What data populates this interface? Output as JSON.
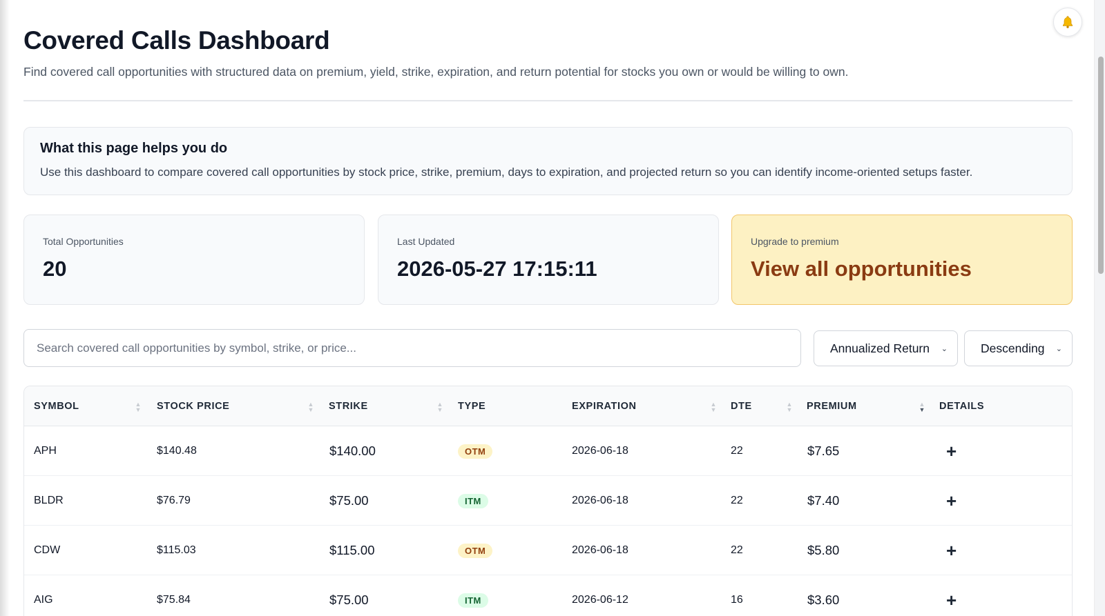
{
  "header": {
    "title": "Covered Calls Dashboard",
    "subtitle": "Find covered call opportunities with structured data on premium, yield, strike, expiration, and return potential for stocks you own or would be willing to own.",
    "bell_icon": "bell-icon"
  },
  "info": {
    "title": "What this page helps you do",
    "text": "Use this dashboard to compare covered call opportunities by stock price, strike, premium, days to expiration, and projected return so you can identify income-oriented setups faster."
  },
  "stats": {
    "total": {
      "label": "Total Opportunities",
      "value": "20"
    },
    "updated": {
      "label": "Last Updated",
      "value": "2026-05-27 17:15:11"
    },
    "premium": {
      "label": "Upgrade to premium",
      "value": "View all opportunities"
    }
  },
  "search": {
    "placeholder": "Search covered call opportunities by symbol, strike, or price...",
    "value": ""
  },
  "sort": {
    "field": "Annualized Return",
    "order": "Descending"
  },
  "table": {
    "columns": [
      "SYMBOL",
      "STOCK PRICE",
      "STRIKE",
      "TYPE",
      "EXPIRATION",
      "DTE",
      "PREMIUM",
      "DETAILS"
    ],
    "active_sort_column": "PREMIUM",
    "rows": [
      {
        "symbol": "APH",
        "stock_price": "$140.48",
        "strike": "$140.00",
        "type": "OTM",
        "expiration": "2026-06-18",
        "dte": "22",
        "premium": "$7.65",
        "details": "+"
      },
      {
        "symbol": "BLDR",
        "stock_price": "$76.79",
        "strike": "$75.00",
        "type": "ITM",
        "expiration": "2026-06-18",
        "dte": "22",
        "premium": "$7.40",
        "details": "+"
      },
      {
        "symbol": "CDW",
        "stock_price": "$115.03",
        "strike": "$115.00",
        "type": "OTM",
        "expiration": "2026-06-18",
        "dte": "22",
        "premium": "$5.80",
        "details": "+"
      },
      {
        "symbol": "AIG",
        "stock_price": "$75.84",
        "strike": "$75.00",
        "type": "ITM",
        "expiration": "2026-06-12",
        "dte": "16",
        "premium": "$3.60",
        "details": "+"
      }
    ]
  },
  "colors": {
    "premium_bg": "#fdf1c3",
    "premium_text": "#8a3b12",
    "otm_badge": "#fdf3c7",
    "itm_badge": "#dcfce7"
  }
}
